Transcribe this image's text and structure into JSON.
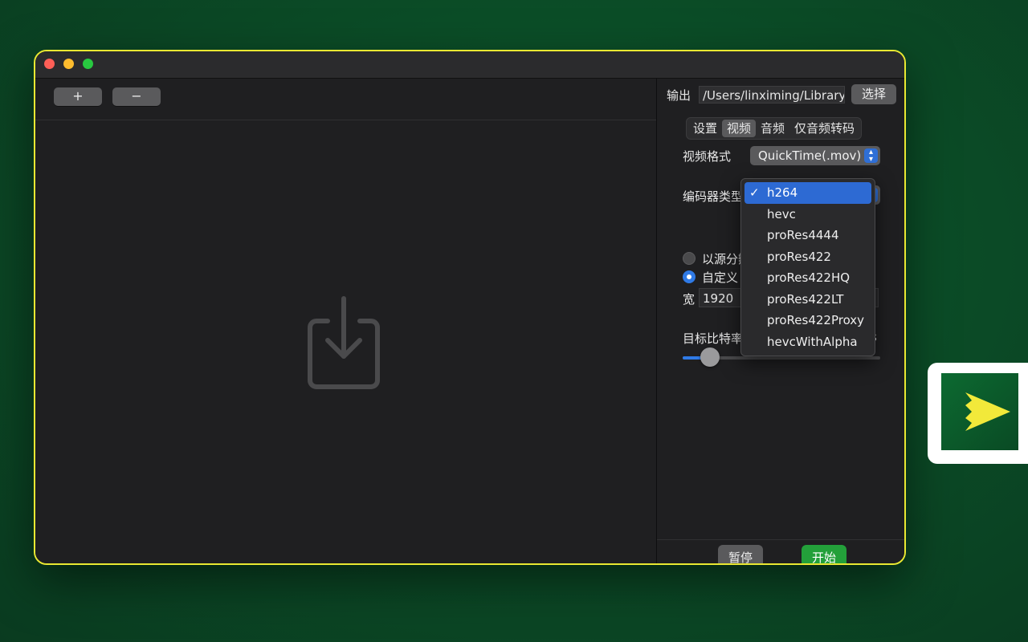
{
  "toolbar": {
    "add_label": "+",
    "remove_label": "−"
  },
  "output": {
    "label": "输出",
    "path": "/Users/linximing/Library/Containers",
    "choose_label": "选择"
  },
  "tabs": [
    {
      "label": "设置",
      "active": false
    },
    {
      "label": "视频",
      "active": true
    },
    {
      "label": "音频",
      "active": false
    },
    {
      "label": "仅音频转码",
      "active": false
    }
  ],
  "video": {
    "format_label": "视频格式",
    "format_value": "QuickTime(.mov)",
    "encoder_label": "编码器类型",
    "source_res_label": "以源分辨率",
    "custom_res_label": "自定义",
    "width_label": "宽",
    "width_value": "1920",
    "bitrate_label": "目标比特率",
    "bitrate_unit": "s",
    "bitrate_fraction": 0.14
  },
  "encoder_menu": {
    "selected": "h264",
    "options": [
      "h264",
      "hevc",
      "proRes4444",
      "proRes422",
      "proRes422HQ",
      "proRes422LT",
      "proRes422Proxy",
      "hevcWithAlpha"
    ]
  },
  "actions": {
    "pause_label": "暂停",
    "start_label": "开始"
  },
  "colors": {
    "accent": "#2f7ae6",
    "start": "#23a03a",
    "window_border": "#e9e832"
  }
}
